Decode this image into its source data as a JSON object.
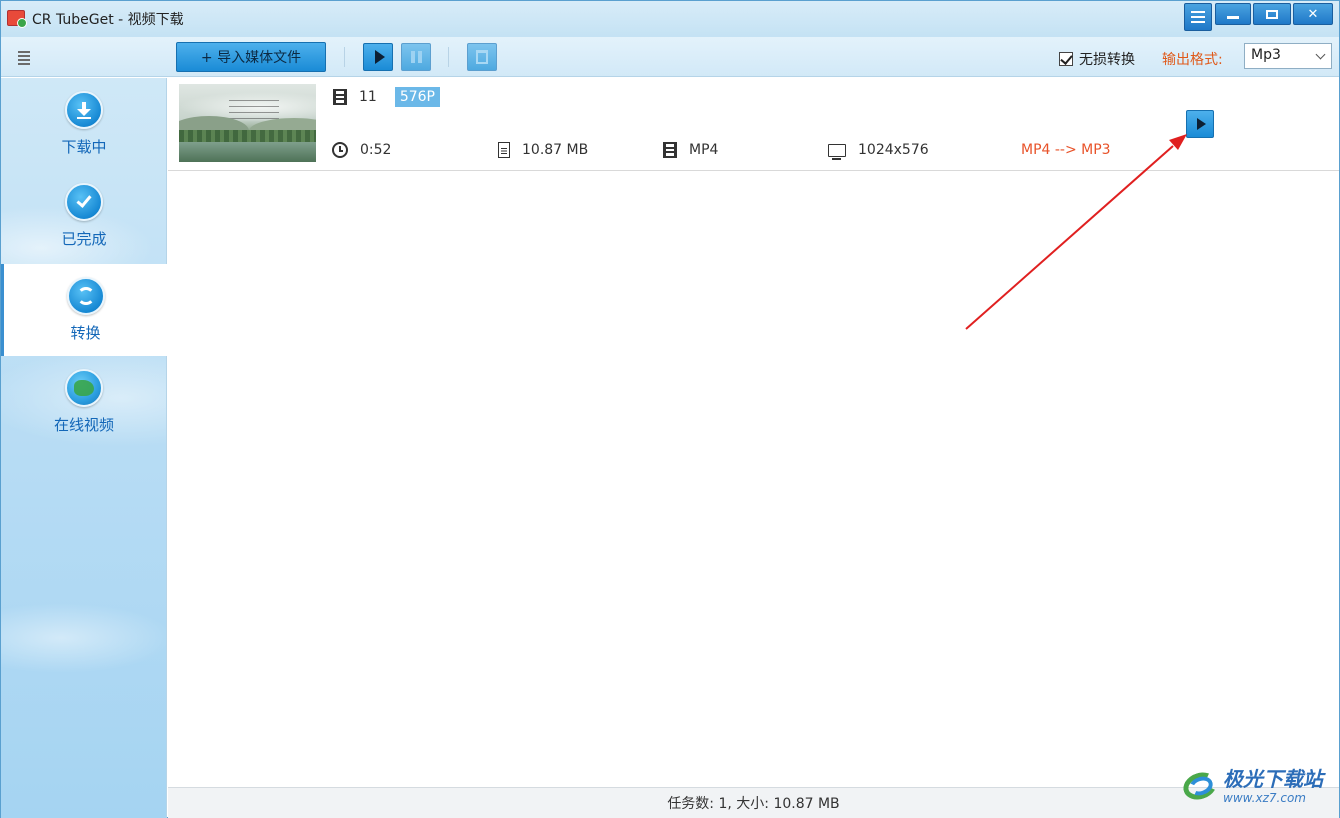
{
  "window": {
    "title": "CR TubeGet - 视频下载"
  },
  "toolbar": {
    "import_label": "+ 导入媒体文件",
    "lossless_label": "无损转换",
    "lossless_checked": true,
    "output_format_label": "输出格式:",
    "output_format_value": "Mp3"
  },
  "sidebar": {
    "items": [
      {
        "label": "下载中",
        "icon": "download-icon",
        "active": false
      },
      {
        "label": "已完成",
        "icon": "check-icon",
        "active": false
      },
      {
        "label": "转换",
        "icon": "convert-icon",
        "active": true
      },
      {
        "label": "在线视频",
        "icon": "globe-icon",
        "active": false
      }
    ]
  },
  "tasks": [
    {
      "name": "11",
      "quality": "576P",
      "duration": "0:52",
      "size": "10.87 MB",
      "format": "MP4",
      "resolution": "1024x576",
      "conversion": "MP4 --> MP3"
    }
  ],
  "status": {
    "text": "任务数: 1, 大小: 10.87 MB"
  },
  "watermark": {
    "brand": "极光下载站",
    "url": "www.xz7.com"
  },
  "colors": {
    "accent": "#1a8bd6",
    "sidebar_label": "#1367b8",
    "conversion_text": "#e8532a",
    "annotation_arrow": "#e02020"
  }
}
